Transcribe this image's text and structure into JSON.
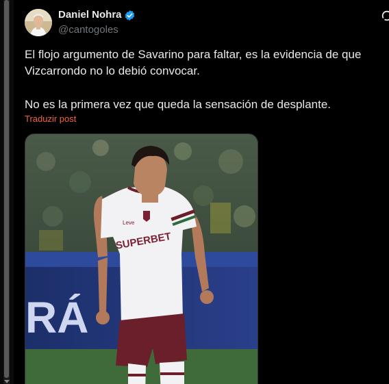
{
  "author": {
    "name": "Daniel Nohra",
    "handle": "@cantogoles",
    "verified": true,
    "avatar_icon": "avatar-photo",
    "verified_icon": "verified-badge-icon"
  },
  "post": {
    "lines": [
      "El flojo argumento de Savarino para faltar, es la evidencia de que",
      "Vizcarrondo no lo debió convocar.",
      "No es la primera vez que queda la sensación de desplante."
    ],
    "translate_label": "Traduzir post",
    "media": {
      "jersey_sponsor": "SUPERBET",
      "jersey_brand": "Leve",
      "banner_text": "RÁ"
    }
  },
  "colors": {
    "background": "#000000",
    "text": "#e7e9ea",
    "secondary": "#71767b",
    "accent": "#f4623a",
    "verified": "#1d9bf0"
  }
}
